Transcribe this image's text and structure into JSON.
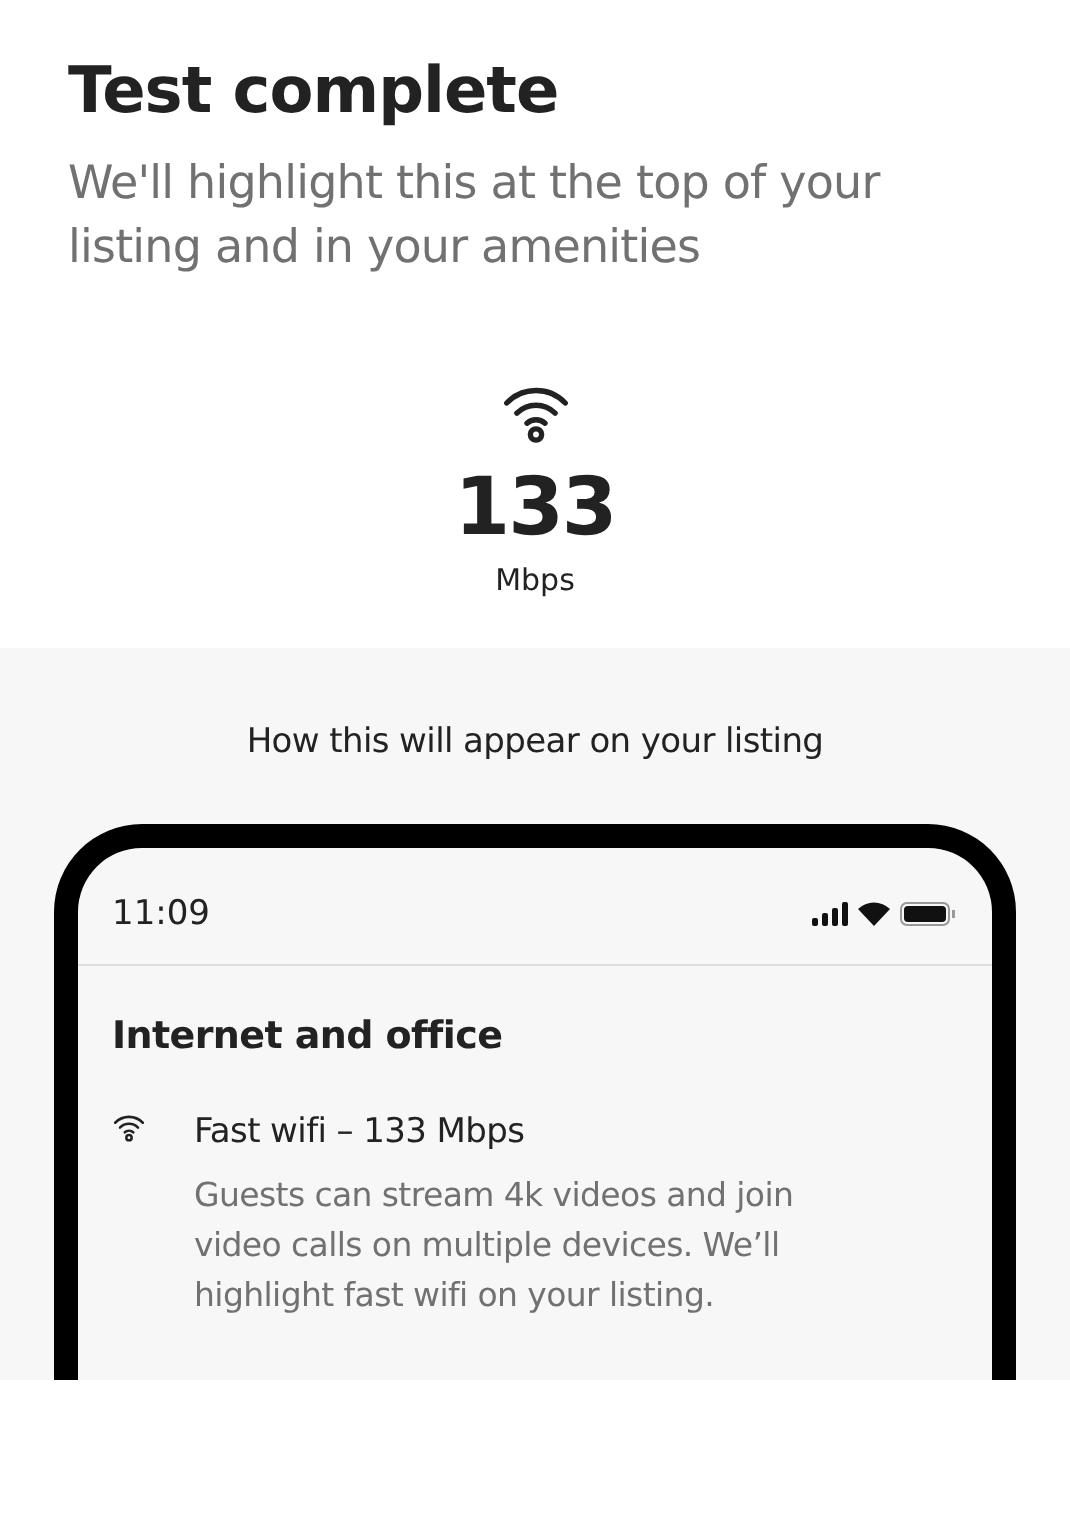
{
  "header": {
    "title": "Test complete",
    "subtitle": "We'll highlight this at the top of your listing and in your amenities"
  },
  "speed": {
    "value": "133",
    "unit": "Mbps"
  },
  "preview": {
    "caption": "How this will appear on your listing",
    "phone": {
      "time": "11:09",
      "section_title": "Internet and office",
      "amenities": [
        {
          "title": "Fast wifi – 133 Mbps",
          "description": "Guests can stream 4k videos and join video calls on multiple devices. We’ll highlight fast wifi on your listing."
        }
      ]
    }
  }
}
